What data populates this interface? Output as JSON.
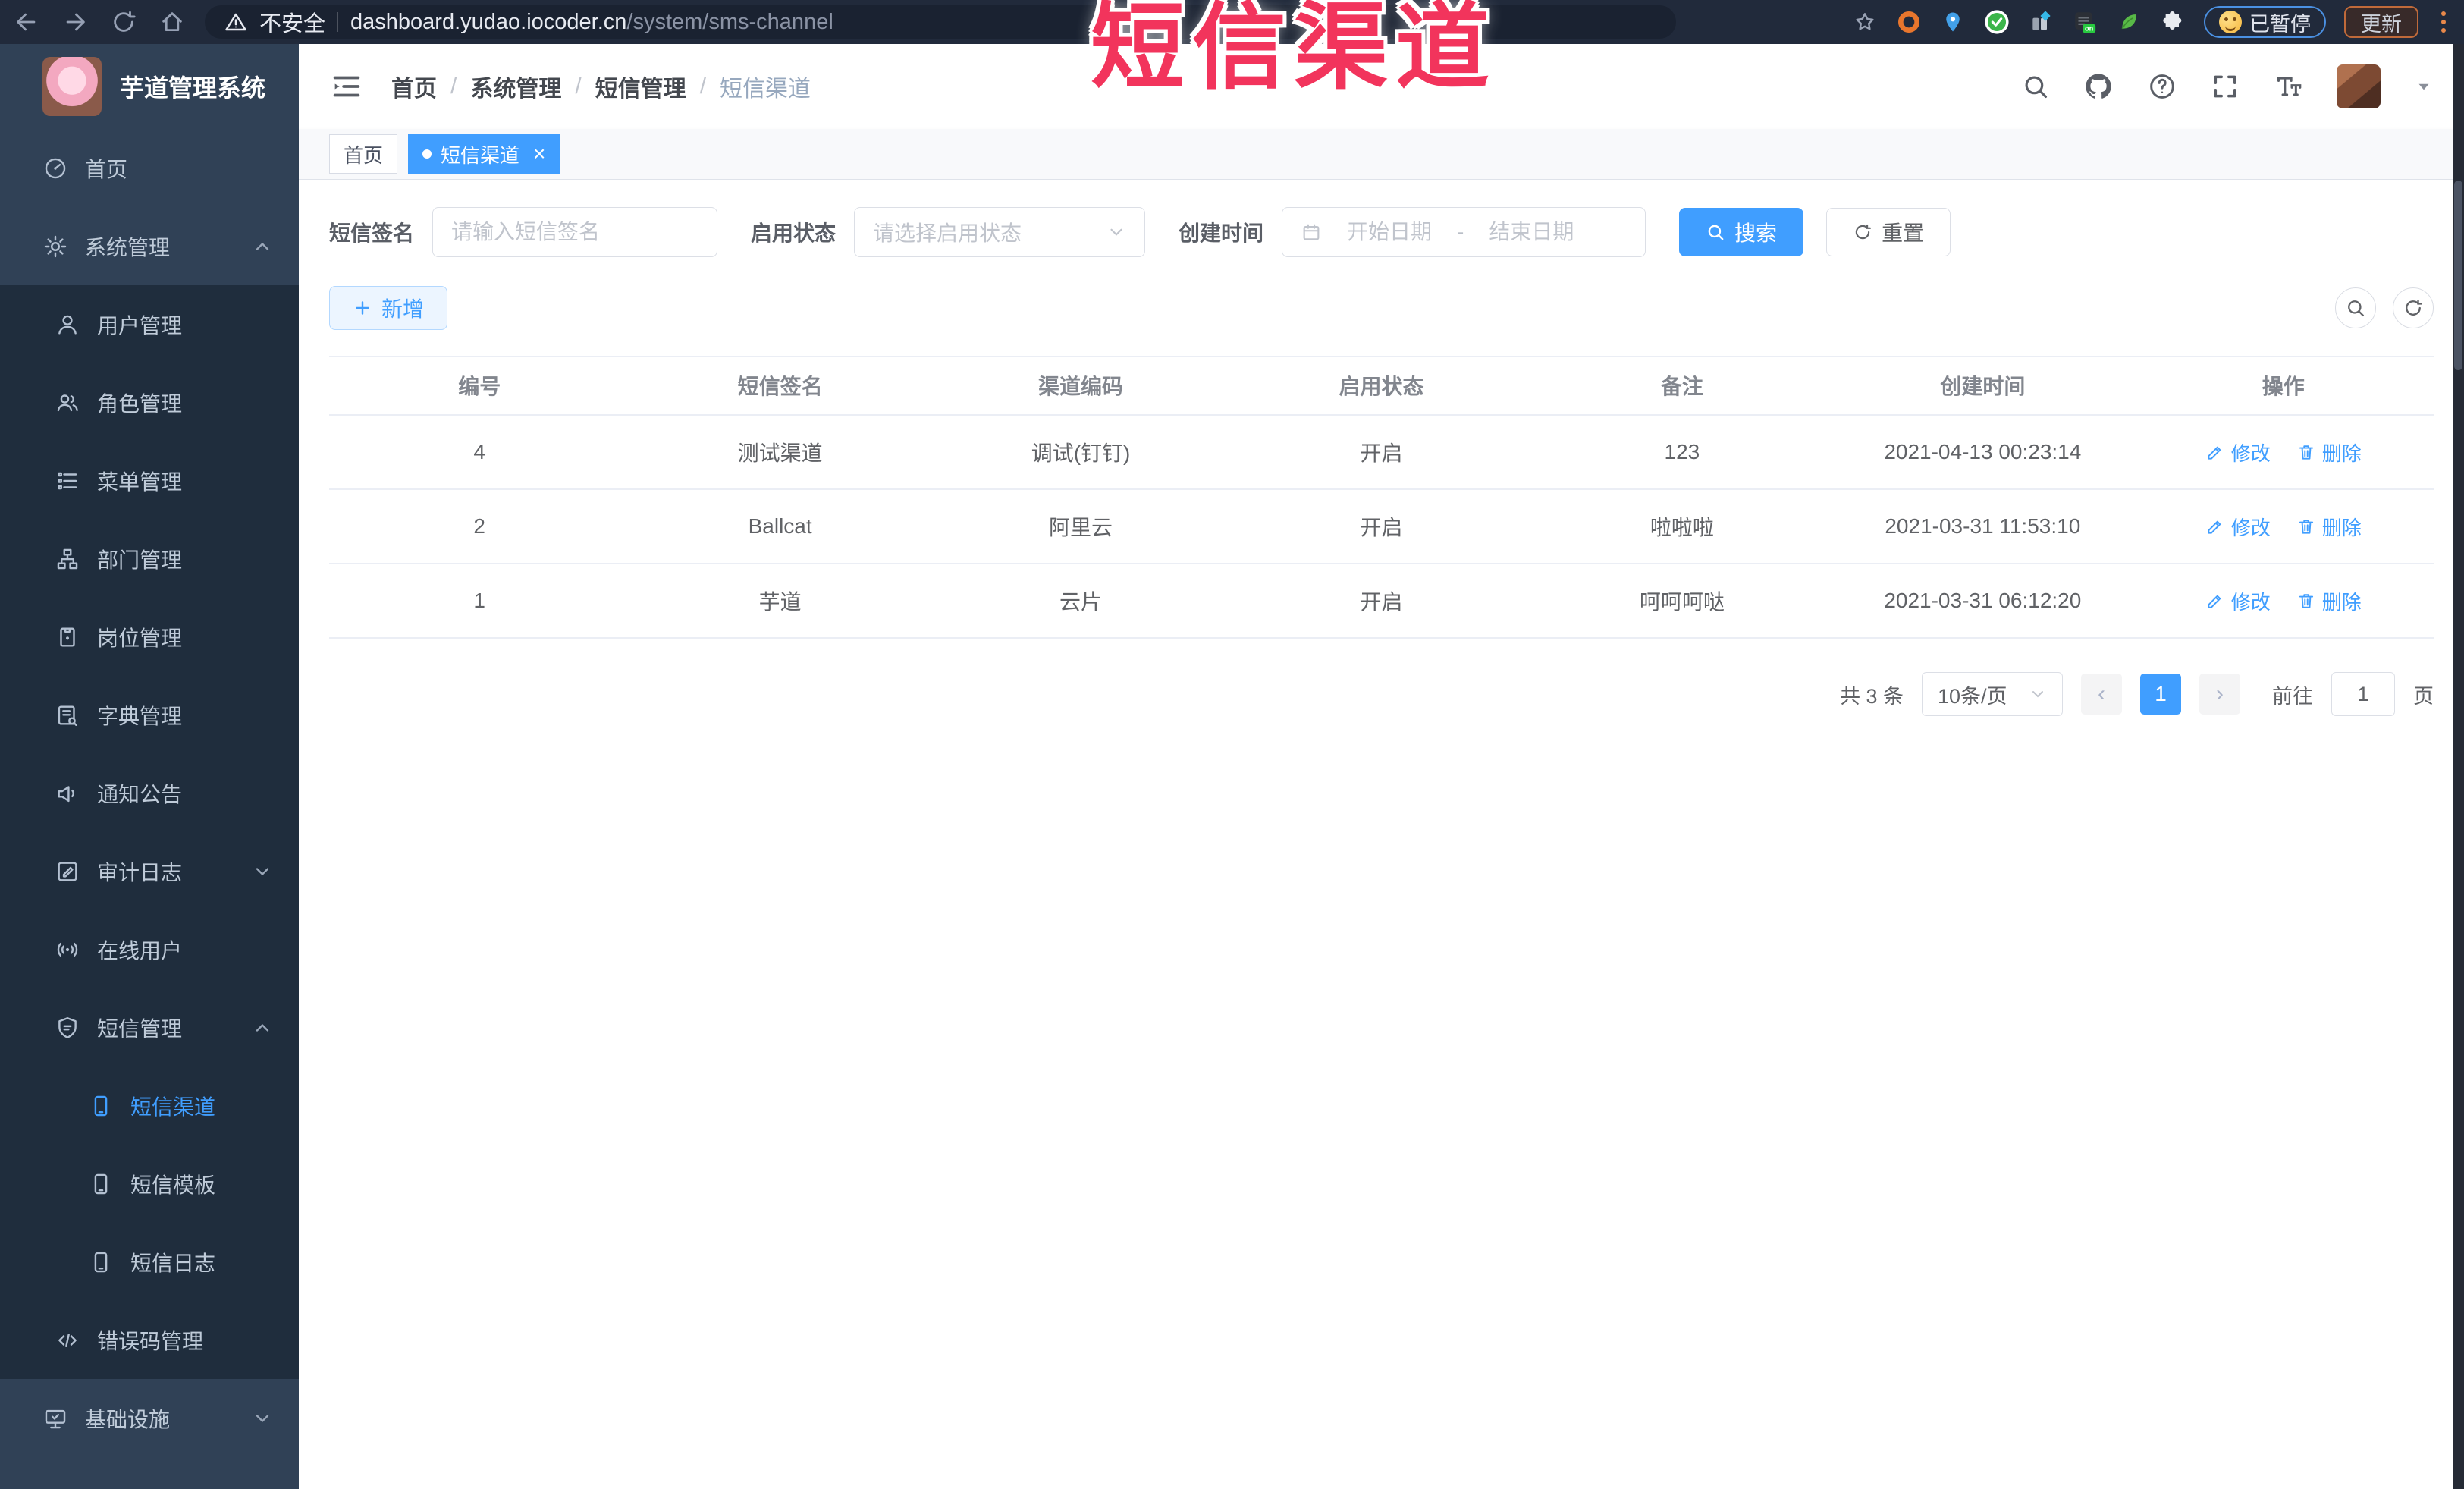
{
  "annotation": {
    "text": "短信渠道",
    "color": "#f2345c"
  },
  "browser": {
    "security_label": "不安全",
    "url_domain": "dashboard.yudao.iocoder.cn",
    "url_path": "/system/sms-channel",
    "ext_badge": "on",
    "paused_label": "已暂停",
    "update_label": "更新"
  },
  "sidebar": {
    "app_title": "芋道管理系统",
    "items": [
      {
        "id": "home",
        "label": "首页",
        "icon": "dashboard-icon",
        "level": 1
      },
      {
        "id": "system",
        "label": "系统管理",
        "icon": "gear-icon",
        "level": 1,
        "arrow": "up"
      },
      {
        "id": "user",
        "label": "用户管理",
        "icon": "user-icon",
        "level": 2
      },
      {
        "id": "role",
        "label": "角色管理",
        "icon": "users-icon",
        "level": 2
      },
      {
        "id": "menu",
        "label": "菜单管理",
        "icon": "menu-list-icon",
        "level": 2
      },
      {
        "id": "dept",
        "label": "部门管理",
        "icon": "org-tree-icon",
        "level": 2
      },
      {
        "id": "post",
        "label": "岗位管理",
        "icon": "badge-icon",
        "level": 2
      },
      {
        "id": "dict",
        "label": "字典管理",
        "icon": "dictionary-icon",
        "level": 2
      },
      {
        "id": "notice",
        "label": "通知公告",
        "icon": "megaphone-icon",
        "level": 2
      },
      {
        "id": "audit-log",
        "label": "审计日志",
        "icon": "audit-log-icon",
        "level": 2,
        "arrow": "down"
      },
      {
        "id": "online-user",
        "label": "在线用户",
        "icon": "online-users-icon",
        "level": 2
      },
      {
        "id": "sms",
        "label": "短信管理",
        "icon": "sms-shield-icon",
        "level": 2,
        "arrow": "up"
      },
      {
        "id": "sms-channel",
        "label": "短信渠道",
        "icon": "phone-icon",
        "level": 3,
        "active": true
      },
      {
        "id": "sms-template",
        "label": "短信模板",
        "icon": "phone-icon",
        "level": 3
      },
      {
        "id": "sms-log",
        "label": "短信日志",
        "icon": "phone-icon",
        "level": 3
      },
      {
        "id": "error-code",
        "label": "错误码管理",
        "icon": "code-icon",
        "level": 2
      },
      {
        "id": "infra",
        "label": "基础设施",
        "icon": "monitor-icon",
        "level": 1,
        "arrow": "down"
      }
    ]
  },
  "header": {
    "breadcrumb": [
      "首页",
      "系统管理",
      "短信管理",
      "短信渠道"
    ]
  },
  "tabs": [
    {
      "label": "首页",
      "active": false,
      "closable": false
    },
    {
      "label": "短信渠道",
      "active": true,
      "closable": true
    }
  ],
  "filters": {
    "sign_label": "短信签名",
    "sign_placeholder": "请输入短信签名",
    "status_label": "启用状态",
    "status_placeholder": "请选择启用状态",
    "date_label": "创建时间",
    "date_start_placeholder": "开始日期",
    "date_separator": "-",
    "date_end_placeholder": "结束日期",
    "search_label": "搜索",
    "reset_label": "重置"
  },
  "toolbar": {
    "add_label": "新增"
  },
  "table": {
    "columns": [
      "编号",
      "短信签名",
      "渠道编码",
      "启用状态",
      "备注",
      "创建时间",
      "操作"
    ],
    "edit_label": "修改",
    "delete_label": "删除",
    "rows": [
      {
        "id": "4",
        "sign": "测试渠道",
        "code": "调试(钉钉)",
        "status": "开启",
        "remark": "123",
        "created": "2021-04-13 00:23:14"
      },
      {
        "id": "2",
        "sign": "Ballcat",
        "code": "阿里云",
        "status": "开启",
        "remark": "啦啦啦",
        "created": "2021-03-31 11:53:10"
      },
      {
        "id": "1",
        "sign": "芋道",
        "code": "云片",
        "status": "开启",
        "remark": "呵呵呵哒",
        "created": "2021-03-31 06:12:20"
      }
    ]
  },
  "pagination": {
    "total_label": "共 3 条",
    "page_size": "10条/页",
    "current_page": "1",
    "goto_label": "前往",
    "goto_value": "1",
    "page_suffix": "页"
  },
  "colors": {
    "primary": "#409eff",
    "sidebar_bg": "#304156",
    "submenu_bg": "#1f2d3d",
    "annotation": "#f2345c"
  }
}
